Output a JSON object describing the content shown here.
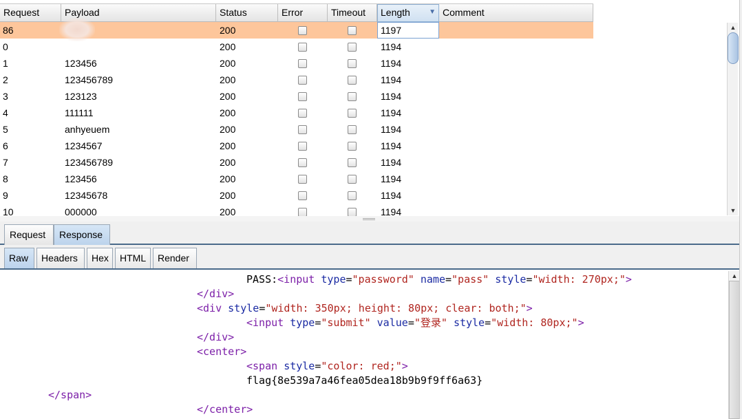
{
  "table": {
    "columns": [
      "Request",
      "Payload",
      "Status",
      "Error",
      "Timeout",
      "Length",
      "Comment"
    ],
    "sorted_column": "Length",
    "rows": [
      {
        "request": "86",
        "payload": "",
        "status": "200",
        "length": "1197",
        "selected": true
      },
      {
        "request": "0",
        "payload": "",
        "status": "200",
        "length": "1194"
      },
      {
        "request": "1",
        "payload": "123456",
        "status": "200",
        "length": "1194"
      },
      {
        "request": "2",
        "payload": "123456789",
        "status": "200",
        "length": "1194"
      },
      {
        "request": "3",
        "payload": "123123",
        "status": "200",
        "length": "1194"
      },
      {
        "request": "4",
        "payload": "111111",
        "status": "200",
        "length": "1194"
      },
      {
        "request": "5",
        "payload": "anhyeuem",
        "status": "200",
        "length": "1194"
      },
      {
        "request": "6",
        "payload": "1234567",
        "status": "200",
        "length": "1194"
      },
      {
        "request": "7",
        "payload": "123456789",
        "status": "200",
        "length": "1194"
      },
      {
        "request": "8",
        "payload": "123456",
        "status": "200",
        "length": "1194"
      },
      {
        "request": "9",
        "payload": "12345678",
        "status": "200",
        "length": "1194"
      },
      {
        "request": "10",
        "payload": "000000",
        "status": "200",
        "length": "1194"
      }
    ]
  },
  "message_tabs": {
    "request": "Request",
    "response": "Response",
    "active": "Response"
  },
  "view_tabs": {
    "raw": "Raw",
    "headers": "Headers",
    "hex": "Hex",
    "html": "HTML",
    "render": "Render",
    "active": "Raw"
  },
  "code": {
    "l1_text": "PASS:",
    "l1_tag_open": "<input",
    "l1_a1": "type",
    "l1_v1": "\"password\"",
    "l1_a2": "name",
    "l1_v2": "\"pass\"",
    "l1_a3": "style",
    "l1_v3": "\"width: 270px;\"",
    "l1_close": ">",
    "l2": "</div>",
    "l3_tag": "<div",
    "l3_a1": "style",
    "l3_v1": "\"width: 350px; height: 80px; clear: both;\"",
    "l3_close": ">",
    "l4_tag": "<input",
    "l4_a1": "type",
    "l4_v1": "\"submit\"",
    "l4_a2": "value",
    "l4_v2": "\"登录\"",
    "l4_a3": "style",
    "l4_v3": "\"width: 80px;\"",
    "l4_close": ">",
    "l5": "</div>",
    "l6": "<center>",
    "l7_tag": "<span",
    "l7_a1": "style",
    "l7_v1": "\"color: red;\"",
    "l7_close": ">",
    "l8": "flag{8e539a7a46fea05dea18b9b9f9ff6a63}",
    "l9": "</span>",
    "l10": "</center>"
  },
  "colors": {
    "selected_row": "#fdc69b",
    "tag": "#7c1fa8",
    "attr": "#1b2ba3",
    "string": "#b0251f"
  },
  "icons": {
    "sort": "triangle-down-icon",
    "scroll_up": "arrow-up-icon",
    "scroll_down": "arrow-down-icon"
  }
}
